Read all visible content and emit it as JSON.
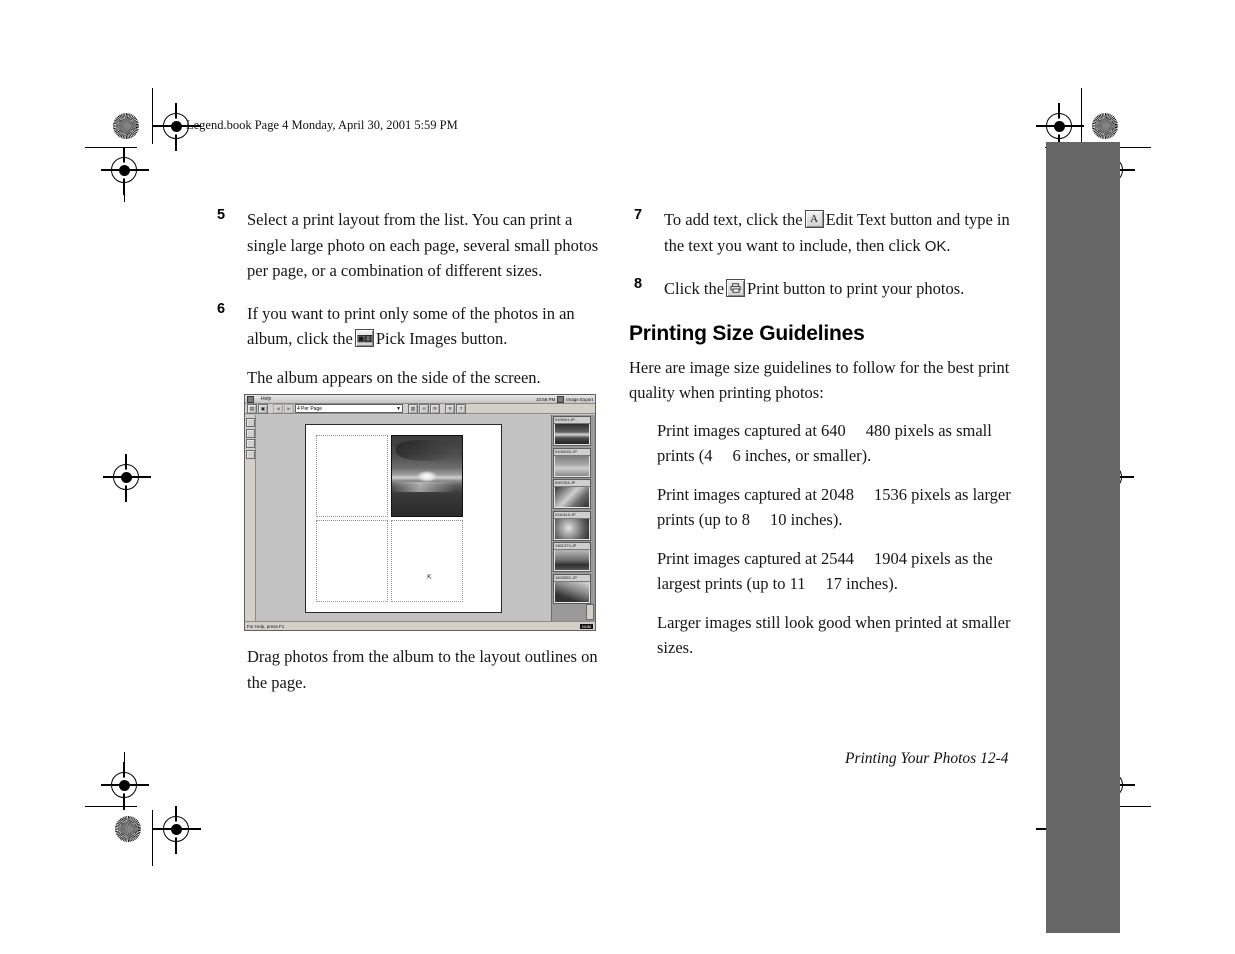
{
  "running_header": "Legend.book  Page 4  Monday, April 30, 2001  5:59 PM",
  "steps_left": [
    {
      "num": "5",
      "text": "Select a print layout from the list. You can print a single large photo on each page, several small photos per page, or a combination of different sizes."
    },
    {
      "num": "6",
      "text_before": "If you want to print only some of the photos in an album, click the",
      "icon": "pick-images-icon",
      "text_after": "Pick Images button."
    }
  ],
  "sub_paragraph": "The album appears on the side of the screen.",
  "figure_caption": "Drag photos from the album to the layout outlines on the page.",
  "steps_right": [
    {
      "num": "7",
      "text_before": "To add text, click the",
      "icon": "edit-text-icon",
      "text_mid": "Edit Text button and type in the text you want to include, then click",
      "ok_label": "OK",
      "text_after": "."
    },
    {
      "num": "8",
      "text_before": "Click the",
      "icon": "print-icon",
      "text_after": "Print button to print your photos."
    }
  ],
  "section": {
    "heading": "Printing Size Guidelines",
    "intro": "Here are image size guidelines to follow for the best print quality when printing photos:",
    "bullets": [
      {
        "p1": "Print images captured at 640",
        "p2": "480 pixels as small prints (4",
        "p3": "6 inches, or smaller)."
      },
      {
        "p1": "Print images captured at 2048",
        "p2": "1536 pixels as larger prints (up to 8",
        "p3": "10 inches)."
      },
      {
        "p1": "Print images captured at 2544",
        "p2": "1904 pixels as the largest prints (up to 11",
        "p3": "17 inches)."
      },
      {
        "p1": "Larger images still look good when printed at smaller sizes.",
        "p2": "",
        "p3": ""
      }
    ]
  },
  "figure": {
    "window_title": "Help",
    "titlebar_right_status": "10:58 PM",
    "album_panel_title": "Image Export",
    "layout_combo_value": "4 Per Page",
    "toolbar_buttons": [
      "new-button",
      "open-button",
      "back-button",
      "forward-button",
      "pick-images-button",
      "edit-text-button",
      "rotate-button",
      "delete-button",
      "help-button"
    ],
    "rail_buttons": [
      "select-tool",
      "zoom-tool",
      "hand-tool",
      "crop-tool"
    ],
    "status_text": "For Help, press F1",
    "status_pill": "NUM",
    "thumbnails": [
      {
        "name": "01091H.JP..."
      },
      {
        "name": "010901D.JP"
      },
      {
        "name": "0007I03.JP"
      },
      {
        "name": "0110110.JP"
      },
      {
        "name": "1301373.JP"
      },
      {
        "name": "140290C.JP"
      }
    ]
  },
  "footer": "Printing Your Photos  12-4",
  "colors": {
    "thumb_tab": "#666666",
    "page_background": "#ffffff",
    "text": "#161616"
  }
}
